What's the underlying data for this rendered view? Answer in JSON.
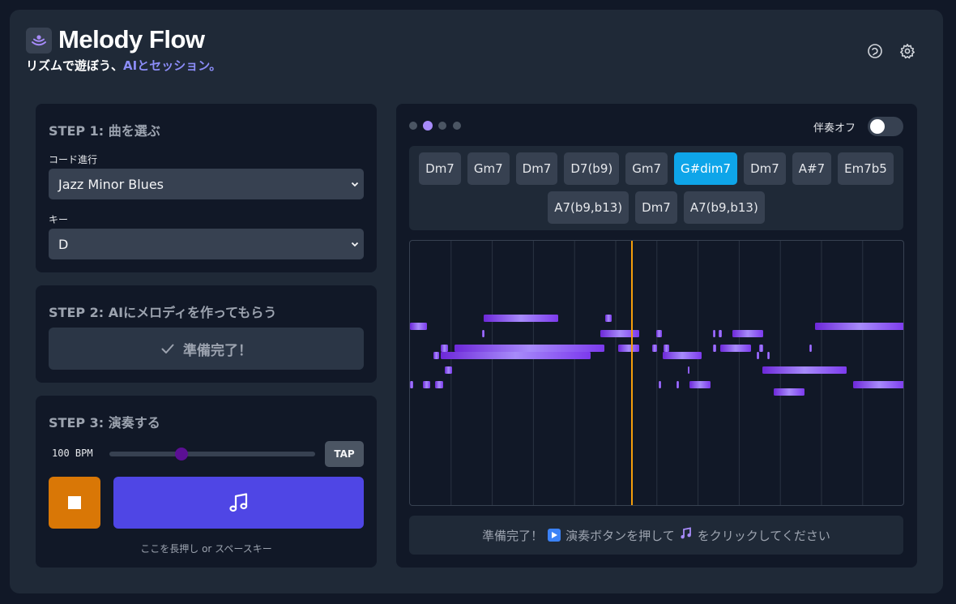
{
  "header": {
    "title": "Melody Flow",
    "tagline_main": "リズムで遊ぼう、",
    "tagline_accent": "AIとセッション。",
    "icons": [
      "refresh-icon",
      "gear-icon"
    ]
  },
  "step1": {
    "title": "STEP 1: 曲を選ぶ",
    "progression_label": "コード進行",
    "progression_value": "Jazz Minor Blues",
    "key_label": "キー",
    "key_value": "D"
  },
  "step2": {
    "title": "STEP 2: AIにメロディを作ってもらう",
    "status": "準備完了！"
  },
  "step3": {
    "title": "STEP 3: 演奏する",
    "bpm_label": "100 BPM",
    "bpm": 100,
    "bpm_fraction": 0.35,
    "tap_label": "TAP",
    "hint": "ここを長押し or スペースキー"
  },
  "player": {
    "toggle_label": "伴奏オフ",
    "toggle_on": false,
    "page_count": 4,
    "active_page": 2,
    "chords_row1": [
      "Dm7",
      "Gm7",
      "Dm7",
      "D7(b9)",
      "Gm7",
      "G#dim7",
      "Dm7",
      "A#7",
      "Em7b5"
    ],
    "chords_row2": [
      "A7(b9,b13)",
      "Dm7",
      "A7(b9,b13)"
    ],
    "active_chord_index": 5,
    "status_before": "準備完了！",
    "status_middle": "演奏ボタンを押して",
    "status_after": "をクリックしてください"
  },
  "colors": {
    "accent": "#4f46e5",
    "active_chord": "#0ea5e9",
    "stop": "#d97706",
    "playhead": "#f59e0b",
    "note": "#7c3aed"
  }
}
